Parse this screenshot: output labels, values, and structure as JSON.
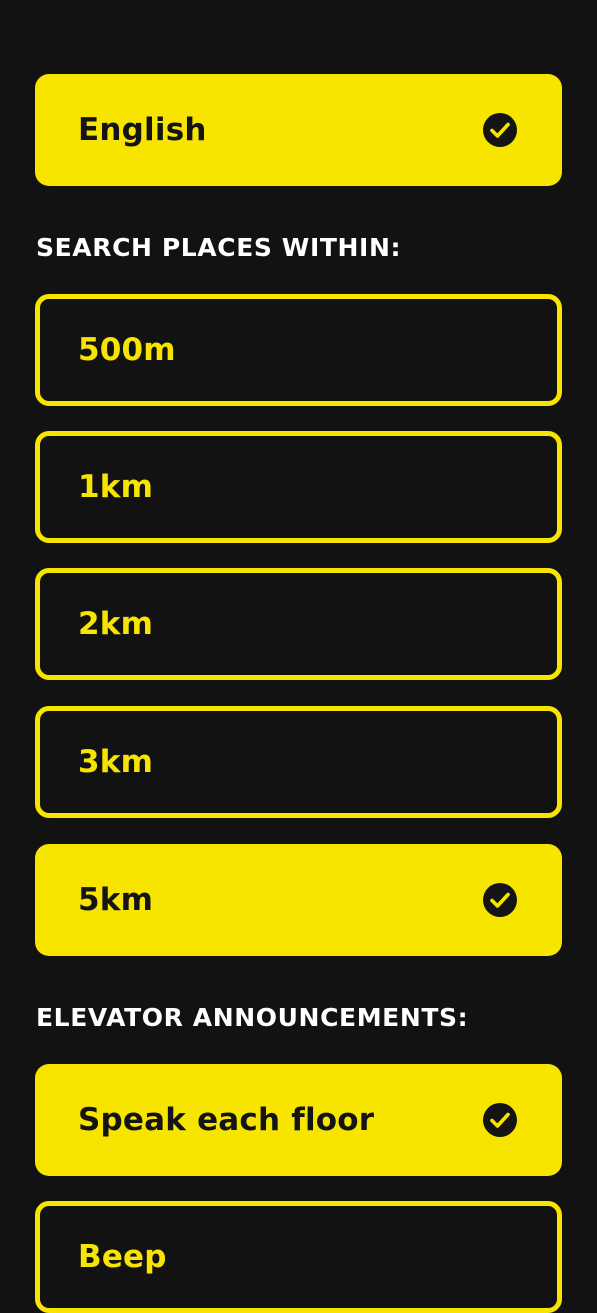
{
  "language": {
    "options": [
      {
        "label": "English",
        "selected": true
      }
    ]
  },
  "search_radius": {
    "title": "SEARCH PLACES WITHIN:",
    "options": [
      {
        "label": "500m",
        "selected": false
      },
      {
        "label": "1km",
        "selected": false
      },
      {
        "label": "2km",
        "selected": false
      },
      {
        "label": "3km",
        "selected": false
      },
      {
        "label": "5km",
        "selected": true
      }
    ]
  },
  "elevator": {
    "title": "ELEVATOR ANNOUNCEMENTS:",
    "options": [
      {
        "label": "Speak each floor",
        "selected": true
      },
      {
        "label": "Beep",
        "selected": false
      }
    ]
  },
  "icons": {
    "selected_marker": "check-circle-icon"
  },
  "colors": {
    "accent": "#f7e500",
    "background": "#121212",
    "text_on_accent": "#141414",
    "section_title": "#ffffff"
  }
}
